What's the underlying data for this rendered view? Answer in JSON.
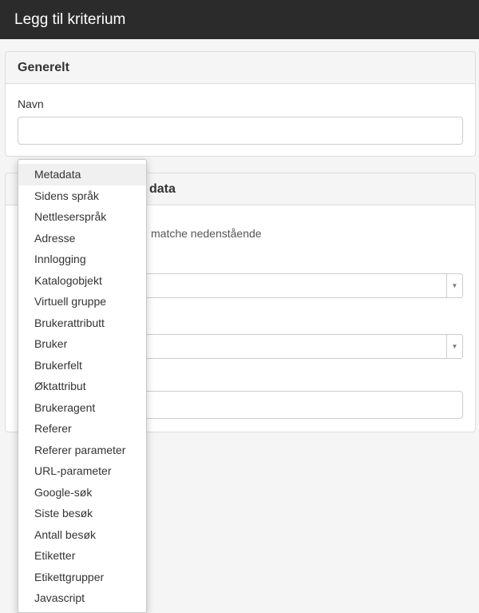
{
  "header": {
    "title": "Legg til kriterium"
  },
  "general_panel": {
    "heading": "Generelt",
    "name_label": "Navn",
    "name_value": ""
  },
  "second_panel": {
    "heading_visible_part": "data",
    "hint_visible_part": "matche nedenstående",
    "text_value": ""
  },
  "dropdown": {
    "selected": "Metadata",
    "items": [
      "Metadata",
      "Sidens språk",
      "Nettleserspråk",
      "Adresse",
      "Innlogging",
      "Katalogobjekt",
      "Virtuell gruppe",
      "Brukerattributt",
      "Bruker",
      "Brukerfelt",
      "Øktattribut",
      "Brukeragent",
      "Referer",
      "Referer parameter",
      "URL-parameter",
      "Google-søk",
      "Siste besøk",
      "Antall besøk",
      "Etiketter",
      "Etikettgrupper",
      "Javascript"
    ]
  }
}
